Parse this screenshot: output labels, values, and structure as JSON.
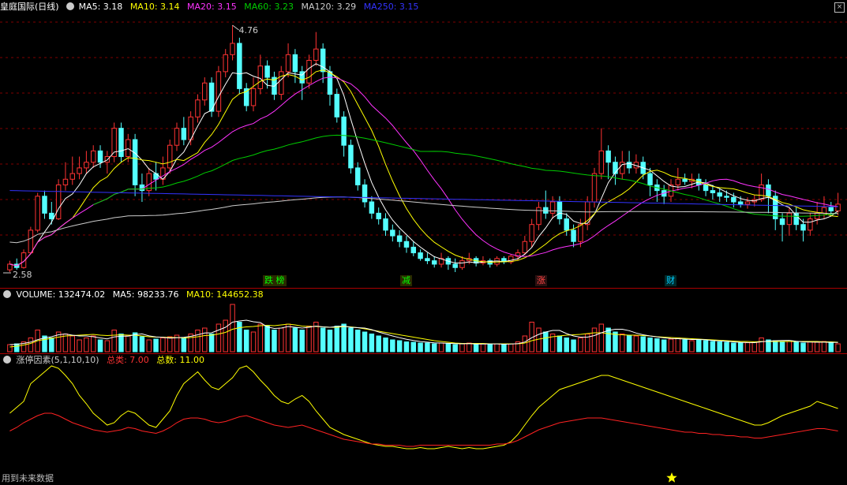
{
  "header": {
    "title": "皇庭国际(日线)",
    "ma": [
      {
        "label": "MA5: 3.18",
        "color": "#ffffff"
      },
      {
        "label": "MA10: 3.14",
        "color": "#ffff00"
      },
      {
        "label": "MA20: 3.15",
        "color": "#ff33ff"
      },
      {
        "label": "MA60: 3.23",
        "color": "#00cc00"
      },
      {
        "label": "MA120: 3.29",
        "color": "#cccccc"
      },
      {
        "label": "MA250: 3.15",
        "color": "#3333ff"
      }
    ]
  },
  "price_labels": {
    "high": "4.76",
    "low": "2.58"
  },
  "events": [
    {
      "label": "跌 榜",
      "color": "#00ff00"
    },
    {
      "label": "减",
      "color": "#00ff00"
    },
    {
      "label": "涨",
      "color": "#ff4444"
    },
    {
      "label": "财",
      "color": "#00ccff"
    }
  ],
  "volume_header": {
    "label": "VOLUME: 132474.02",
    "ma5": "MA5: 98233.76",
    "ma10": "MA10: 144652.38"
  },
  "indicator_header": {
    "name": "涨停因素(5,1,10,10)",
    "total_label": "总类: 7.00",
    "count_label": "总数: 11.00"
  },
  "footer": {
    "note": "用到未来数据"
  },
  "colors": {
    "up": "#ff3333",
    "down": "#54ffff",
    "grid": "#800000"
  },
  "chart_data": {
    "type": "candlestick",
    "price_range": [
      2.58,
      4.76
    ],
    "candles": [
      [
        2.6,
        2.65,
        2.68,
        2.58
      ],
      [
        2.65,
        2.62,
        2.7,
        2.6
      ],
      [
        2.62,
        2.75,
        2.78,
        2.61
      ],
      [
        2.75,
        2.95,
        2.98,
        2.74
      ],
      [
        2.95,
        3.25,
        3.28,
        2.93
      ],
      [
        3.25,
        3.1,
        3.3,
        3.05
      ],
      [
        3.1,
        3.05,
        3.2,
        3.0
      ],
      [
        3.05,
        3.35,
        3.4,
        3.04
      ],
      [
        3.35,
        3.4,
        3.55,
        3.3
      ],
      [
        3.4,
        3.45,
        3.6,
        3.35
      ],
      [
        3.45,
        3.5,
        3.6,
        3.4
      ],
      [
        3.5,
        3.55,
        3.65,
        3.45
      ],
      [
        3.55,
        3.65,
        3.7,
        3.5
      ],
      [
        3.65,
        3.55,
        3.7,
        3.5
      ],
      [
        3.55,
        3.6,
        3.65,
        3.45
      ],
      [
        3.6,
        3.85,
        3.9,
        3.55
      ],
      [
        3.85,
        3.6,
        3.9,
        3.55
      ],
      [
        3.6,
        3.75,
        3.8,
        3.55
      ],
      [
        3.75,
        3.35,
        3.8,
        3.25
      ],
      [
        3.35,
        3.3,
        3.45,
        3.2
      ],
      [
        3.3,
        3.45,
        3.5,
        3.25
      ],
      [
        3.45,
        3.4,
        3.55,
        3.3
      ],
      [
        3.4,
        3.5,
        3.6,
        3.35
      ],
      [
        3.5,
        3.7,
        3.75,
        3.45
      ],
      [
        3.7,
        3.85,
        3.9,
        3.65
      ],
      [
        3.85,
        3.75,
        3.95,
        3.7
      ],
      [
        3.75,
        3.95,
        4.0,
        3.7
      ],
      [
        3.95,
        4.1,
        4.15,
        3.9
      ],
      [
        4.1,
        4.25,
        4.3,
        4.05
      ],
      [
        4.25,
        4.0,
        4.3,
        3.95
      ],
      [
        4.0,
        4.35,
        4.4,
        3.95
      ],
      [
        4.35,
        4.5,
        4.55,
        4.3
      ],
      [
        4.5,
        4.6,
        4.76,
        4.45
      ],
      [
        4.6,
        4.2,
        4.65,
        4.15
      ],
      [
        4.2,
        4.05,
        4.25,
        4.0
      ],
      [
        4.05,
        4.2,
        4.3,
        4.0
      ],
      [
        4.2,
        4.4,
        4.5,
        4.15
      ],
      [
        4.4,
        4.3,
        4.45,
        4.2
      ],
      [
        4.3,
        4.15,
        4.35,
        4.1
      ],
      [
        4.15,
        4.35,
        4.4,
        4.1
      ],
      [
        4.35,
        4.5,
        4.6,
        4.3
      ],
      [
        4.5,
        4.35,
        4.55,
        4.25
      ],
      [
        4.35,
        4.25,
        4.4,
        4.1
      ],
      [
        4.25,
        4.45,
        4.5,
        4.2
      ],
      [
        4.45,
        4.55,
        4.7,
        4.4
      ],
      [
        4.55,
        4.35,
        4.6,
        4.25
      ],
      [
        4.35,
        4.15,
        4.4,
        4.05
      ],
      [
        4.15,
        3.95,
        4.2,
        3.9
      ],
      [
        3.95,
        3.7,
        4.0,
        3.6
      ],
      [
        3.7,
        3.5,
        3.75,
        3.45
      ],
      [
        3.5,
        3.35,
        3.55,
        3.3
      ],
      [
        3.35,
        3.2,
        3.4,
        3.15
      ],
      [
        3.2,
        3.1,
        3.25,
        3.05
      ],
      [
        3.1,
        3.05,
        3.15,
        3.0
      ],
      [
        3.05,
        2.95,
        3.1,
        2.9
      ],
      [
        2.95,
        2.9,
        3.0,
        2.85
      ],
      [
        2.9,
        2.85,
        2.95,
        2.8
      ],
      [
        2.85,
        2.8,
        2.9,
        2.75
      ],
      [
        2.8,
        2.75,
        2.85,
        2.72
      ],
      [
        2.75,
        2.7,
        2.78,
        2.68
      ],
      [
        2.7,
        2.68,
        2.75,
        2.65
      ],
      [
        2.68,
        2.65,
        2.72,
        2.62
      ],
      [
        2.65,
        2.7,
        2.75,
        2.62
      ],
      [
        2.7,
        2.65,
        2.72,
        2.6
      ],
      [
        2.65,
        2.62,
        2.7,
        2.58
      ],
      [
        2.62,
        2.68,
        2.72,
        2.6
      ],
      [
        2.68,
        2.7,
        2.75,
        2.65
      ],
      [
        2.7,
        2.66,
        2.72,
        2.63
      ],
      [
        2.66,
        2.68,
        2.72,
        2.64
      ],
      [
        2.68,
        2.65,
        2.7,
        2.62
      ],
      [
        2.65,
        2.7,
        2.72,
        2.63
      ],
      [
        2.7,
        2.67,
        2.72,
        2.65
      ],
      [
        2.67,
        2.72,
        2.74,
        2.65
      ],
      [
        2.72,
        2.75,
        2.78,
        2.68
      ],
      [
        2.75,
        2.85,
        2.9,
        2.73
      ],
      [
        2.85,
        3.0,
        3.05,
        2.8
      ],
      [
        3.0,
        3.15,
        3.2,
        2.95
      ],
      [
        3.15,
        3.1,
        3.3,
        3.05
      ],
      [
        3.1,
        3.2,
        3.25,
        3.05
      ],
      [
        3.2,
        3.05,
        3.25,
        3.0
      ],
      [
        3.05,
        2.95,
        3.1,
        2.9
      ],
      [
        2.95,
        2.85,
        3.0,
        2.8
      ],
      [
        2.85,
        3.0,
        3.05,
        2.8
      ],
      [
        3.0,
        3.2,
        3.25,
        2.95
      ],
      [
        3.2,
        3.45,
        3.5,
        3.15
      ],
      [
        3.45,
        3.65,
        3.85,
        3.4
      ],
      [
        3.65,
        3.55,
        3.7,
        3.4
      ],
      [
        3.55,
        3.45,
        3.6,
        3.35
      ],
      [
        3.45,
        3.55,
        3.65,
        3.4
      ],
      [
        3.55,
        3.5,
        3.65,
        3.45
      ],
      [
        3.5,
        3.55,
        3.62,
        3.45
      ],
      [
        3.55,
        3.45,
        3.6,
        3.4
      ],
      [
        3.45,
        3.35,
        3.5,
        3.25
      ],
      [
        3.35,
        3.3,
        3.4,
        3.2
      ],
      [
        3.3,
        3.25,
        3.35,
        3.18
      ],
      [
        3.25,
        3.35,
        3.4,
        3.2
      ],
      [
        3.35,
        3.4,
        3.5,
        3.3
      ],
      [
        3.4,
        3.38,
        3.45,
        3.35
      ],
      [
        3.38,
        3.4,
        3.45,
        3.32
      ],
      [
        3.4,
        3.35,
        3.45,
        3.3
      ],
      [
        3.35,
        3.3,
        3.4,
        3.25
      ],
      [
        3.3,
        3.28,
        3.35,
        3.22
      ],
      [
        3.28,
        3.25,
        3.32,
        3.2
      ],
      [
        3.25,
        3.24,
        3.3,
        3.2
      ],
      [
        3.24,
        3.2,
        3.28,
        3.15
      ],
      [
        3.2,
        3.18,
        3.25,
        3.15
      ],
      [
        3.18,
        3.2,
        3.24,
        3.14
      ],
      [
        3.2,
        3.22,
        3.26,
        3.16
      ],
      [
        3.22,
        3.35,
        3.45,
        3.2
      ],
      [
        3.35,
        3.25,
        3.4,
        3.1
      ],
      [
        3.25,
        3.05,
        3.3,
        2.95
      ],
      [
        3.05,
        3.0,
        3.1,
        2.85
      ],
      [
        3.0,
        3.1,
        3.15,
        2.9
      ],
      [
        3.1,
        3.0,
        3.15,
        2.95
      ],
      [
        3.0,
        2.95,
        3.05,
        2.85
      ],
      [
        2.95,
        3.05,
        3.1,
        2.9
      ],
      [
        3.05,
        3.1,
        3.2,
        3.0
      ],
      [
        3.1,
        3.15,
        3.25,
        3.05
      ],
      [
        3.15,
        3.12,
        3.2,
        3.08
      ],
      [
        3.12,
        3.18,
        3.28,
        3.08
      ]
    ],
    "volume": [
      18,
      20,
      25,
      35,
      55,
      40,
      35,
      50,
      45,
      40,
      30,
      35,
      40,
      30,
      28,
      55,
      45,
      40,
      48,
      38,
      30,
      32,
      35,
      38,
      42,
      35,
      45,
      55,
      60,
      45,
      70,
      80,
      120,
      75,
      55,
      50,
      70,
      65,
      55,
      60,
      70,
      60,
      55,
      65,
      75,
      60,
      55,
      65,
      70,
      60,
      55,
      50,
      45,
      40,
      35,
      30,
      28,
      25,
      24,
      22,
      22,
      20,
      22,
      20,
      18,
      20,
      22,
      18,
      20,
      19,
      20,
      18,
      20,
      25,
      40,
      75,
      60,
      50,
      45,
      40,
      35,
      30,
      35,
      45,
      60,
      70,
      60,
      50,
      45,
      42,
      40,
      38,
      35,
      33,
      30,
      32,
      35,
      30,
      28,
      30,
      28,
      26,
      25,
      24,
      22,
      22,
      23,
      24,
      35,
      30,
      28,
      25,
      26,
      24,
      22,
      25,
      24,
      26,
      22,
      20
    ],
    "volume_ma10": [
      12,
      14,
      17,
      21,
      28,
      31,
      34,
      37,
      40,
      41,
      42,
      43,
      44,
      42,
      41,
      42,
      43,
      42,
      42,
      40,
      38,
      37,
      37,
      36,
      36,
      35,
      36,
      38,
      41,
      42,
      45,
      49,
      57,
      61,
      63,
      64,
      66,
      67,
      66,
      68,
      70,
      68,
      65,
      64,
      64,
      63,
      62,
      62,
      64,
      63,
      61,
      58,
      55,
      52,
      49,
      46,
      43,
      40,
      37,
      34,
      31,
      28,
      26,
      24,
      22,
      21,
      21,
      21,
      21,
      20,
      20,
      20,
      20,
      20,
      22,
      28,
      32,
      35,
      38,
      40,
      42,
      43,
      44,
      46,
      48,
      48,
      46,
      44,
      43,
      42,
      42,
      41,
      40,
      38,
      37,
      36,
      35,
      34,
      33,
      32,
      31,
      30,
      29,
      28,
      27,
      26,
      26,
      25,
      26,
      26,
      26,
      26,
      26,
      26,
      26,
      26,
      26,
      25,
      25,
      24
    ],
    "indicator_yellow": [
      60,
      65,
      70,
      85,
      90,
      95,
      100,
      98,
      92,
      85,
      75,
      68,
      60,
      55,
      50,
      52,
      58,
      62,
      60,
      55,
      50,
      48,
      55,
      62,
      75,
      85,
      90,
      95,
      88,
      82,
      80,
      85,
      90,
      98,
      100,
      95,
      88,
      82,
      75,
      70,
      68,
      72,
      75,
      70,
      62,
      55,
      48,
      45,
      42,
      40,
      38,
      36,
      34,
      33,
      32,
      32,
      31,
      30,
      30,
      31,
      30,
      30,
      31,
      32,
      31,
      30,
      31,
      30,
      30,
      31,
      32,
      33,
      36,
      42,
      50,
      58,
      65,
      70,
      75,
      80,
      82,
      84,
      86,
      88,
      90,
      92,
      92,
      90,
      88,
      86,
      84,
      82,
      80,
      78,
      76,
      74,
      72,
      70,
      68,
      66,
      64,
      62,
      60,
      58,
      56,
      54,
      52,
      50,
      50,
      52,
      55,
      58,
      60,
      62,
      64,
      66,
      70,
      68,
      66,
      64
    ],
    "indicator_red": [
      45,
      48,
      52,
      55,
      58,
      60,
      60,
      58,
      55,
      52,
      50,
      48,
      46,
      45,
      44,
      45,
      46,
      48,
      47,
      45,
      44,
      43,
      45,
      48,
      52,
      55,
      56,
      56,
      55,
      53,
      52,
      53,
      55,
      57,
      58,
      56,
      54,
      52,
      50,
      49,
      48,
      49,
      50,
      48,
      46,
      44,
      42,
      40,
      38,
      37,
      36,
      35,
      34,
      34,
      33,
      33,
      33,
      32,
      32,
      33,
      33,
      33,
      33,
      33,
      33,
      33,
      33,
      33,
      33,
      33,
      34,
      34,
      35,
      37,
      40,
      43,
      46,
      48,
      50,
      52,
      53,
      54,
      55,
      56,
      56,
      56,
      55,
      54,
      53,
      52,
      51,
      50,
      49,
      48,
      47,
      46,
      45,
      44,
      44,
      43,
      43,
      42,
      42,
      41,
      41,
      40,
      40,
      39,
      39,
      40,
      41,
      42,
      43,
      44,
      45,
      46,
      47,
      47,
      46,
      45
    ]
  }
}
